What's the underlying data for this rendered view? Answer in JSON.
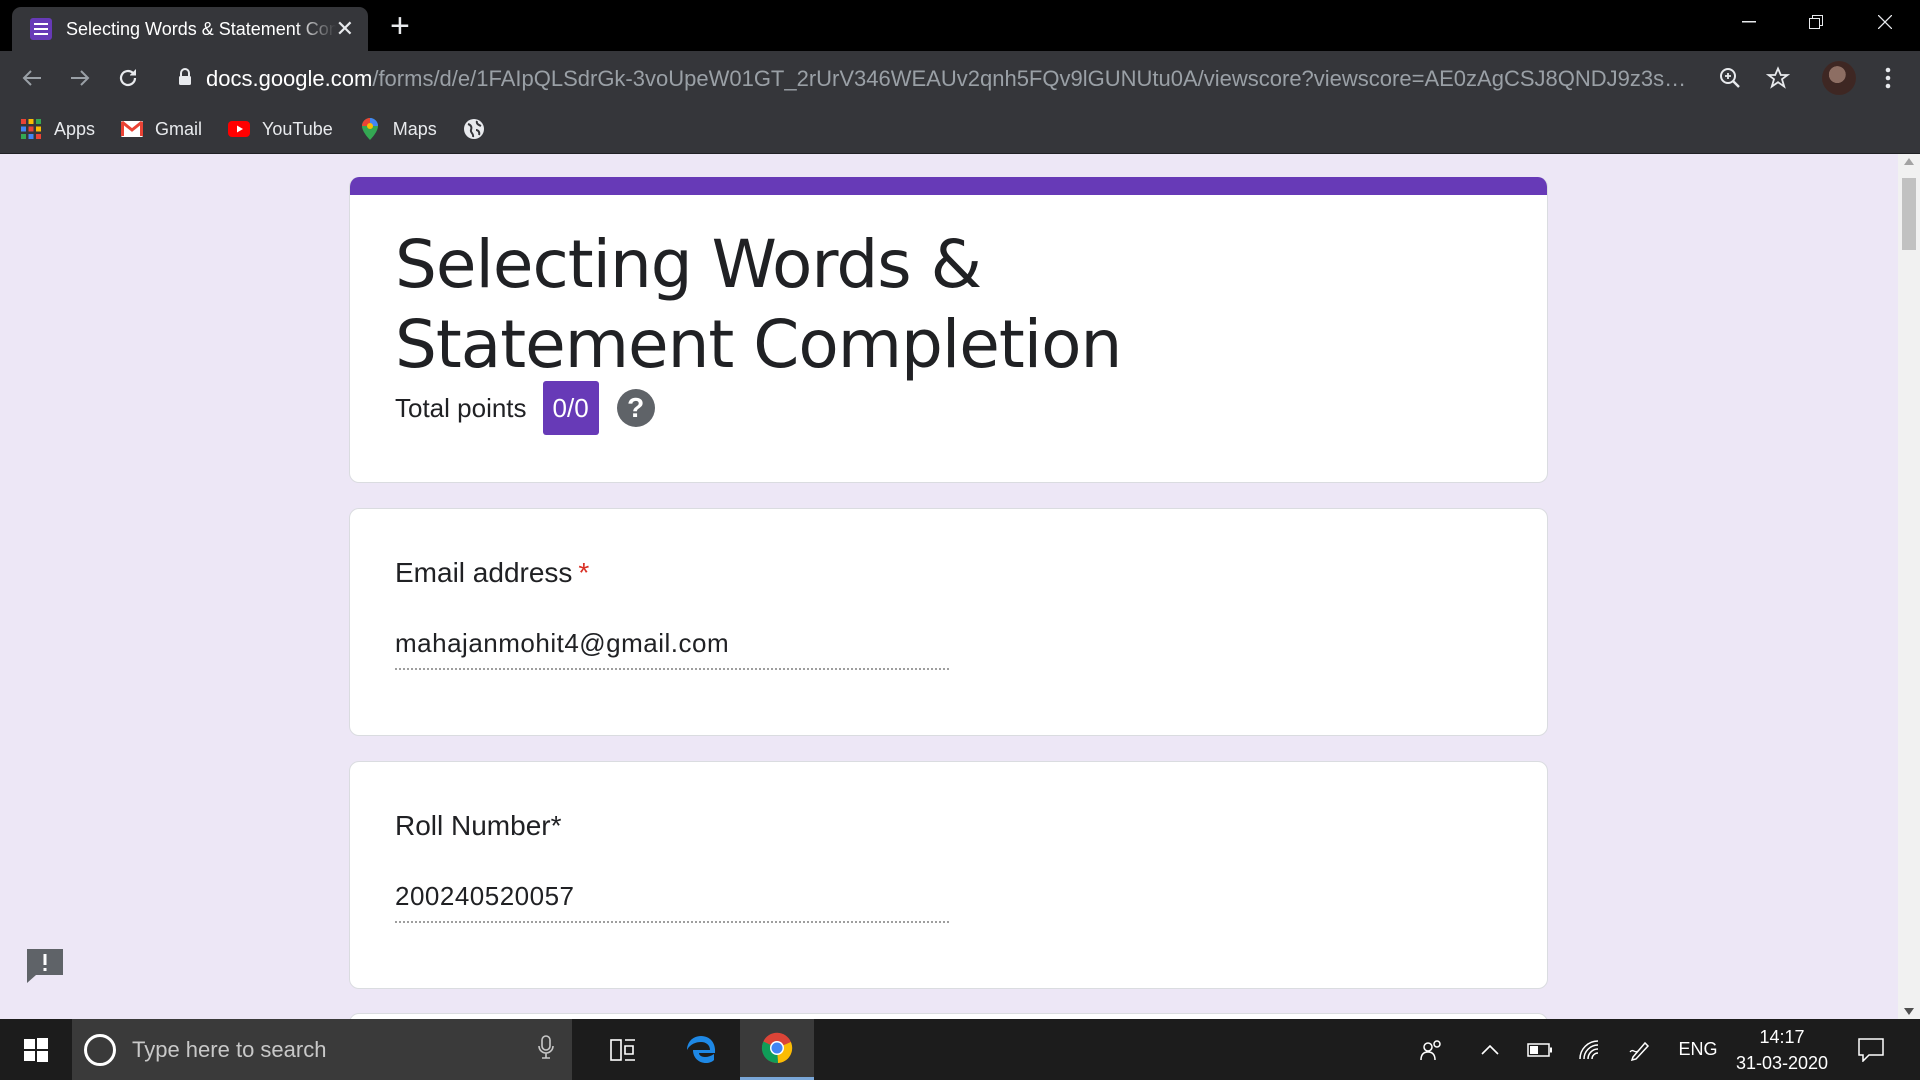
{
  "browser": {
    "tab_title": "Selecting Words & Statement Completion",
    "url_host": "docs.google.com",
    "url_path": "/forms/d/e/1FAIpQLSdrGk-3voUpeW01GT_2rUrV346WEAUv2qnh5FQv9lGUNUtu0A/viewscore?viewscore=AE0zAgCSJ8QNDJ9z3sdEoJYrlnmD4..."
  },
  "bookmarks": [
    {
      "label": "Apps",
      "icon": "apps-grid-icon"
    },
    {
      "label": "Gmail",
      "icon": "gmail-icon"
    },
    {
      "label": "YouTube",
      "icon": "youtube-icon"
    },
    {
      "label": "Maps",
      "icon": "maps-pin-icon"
    }
  ],
  "form": {
    "title": "Selecting Words & Statement Completion",
    "points_label": "Total points",
    "points_value": "0/0",
    "accent_color": "#673ab7",
    "questions": [
      {
        "title": "Email address",
        "required_mark": "*",
        "answer": "mahajanmohit4@gmail.com"
      },
      {
        "title": "Roll Number*",
        "required_mark": "",
        "answer": "200240520057"
      }
    ]
  },
  "taskbar": {
    "search_placeholder": "Type here to search",
    "language": "ENG",
    "time": "14:17",
    "date": "31-03-2020"
  }
}
